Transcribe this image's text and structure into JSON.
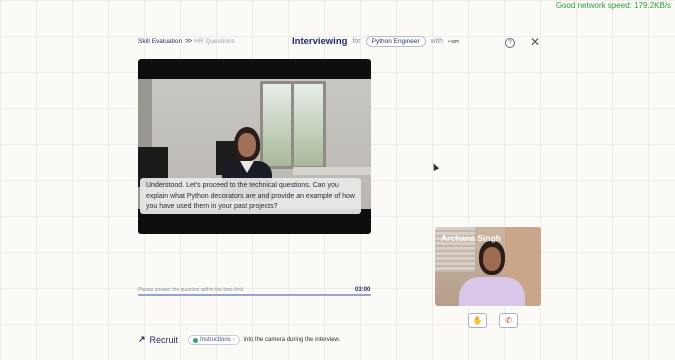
{
  "network": {
    "status": "Good network speed: 179.2KB/s"
  },
  "breadcrumb": {
    "level1": "Skill Evaluation",
    "separator": ">>",
    "level2": "HR Questions"
  },
  "header": {
    "title": "Interviewing",
    "for_text": "for",
    "role": "Python Engineer",
    "with_text": "with",
    "partner_logo": "• wm"
  },
  "avatar_caption": "Understood. Let's proceed to the technical questions. Can you explain what Python decorators are and provide an example of how you have used them in your past projects?",
  "answer": {
    "hint": "Please answer the question within the time limit",
    "timer": "03:00",
    "progress": 1.0
  },
  "footer": {
    "brand": "Recruit",
    "instructions_label": "Instructions",
    "instructions_text": "into the camera during the interview."
  },
  "camera": {
    "name": "Archana Singh"
  },
  "icons": [
    "help-icon",
    "close-icon",
    "raise-hand-icon",
    "end-call-icon",
    "recruit-logo-icon",
    "instructions-icon"
  ]
}
